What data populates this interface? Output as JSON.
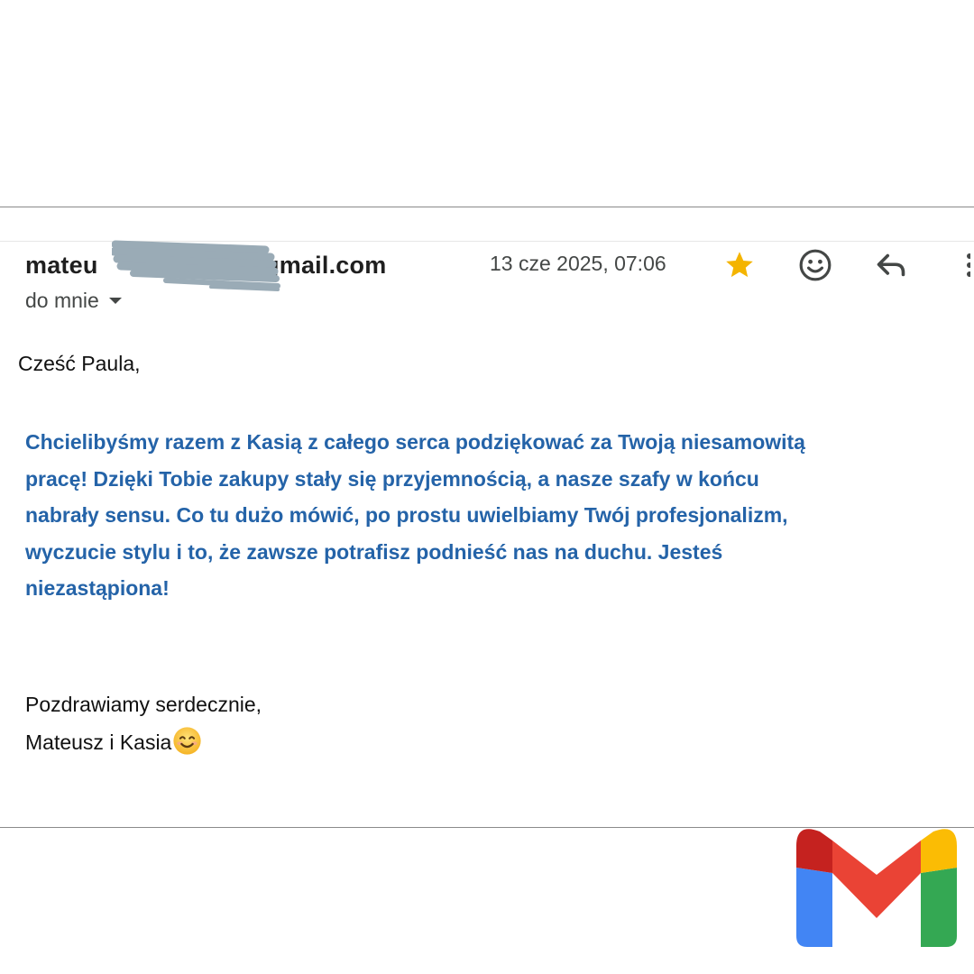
{
  "email": {
    "sender_visible_start": "mateu",
    "sender_visible_end": "@gmail.com",
    "date": "13 cze 2025, 07:06",
    "recipient_label": "do mnie",
    "starred": true,
    "star_color": "#f4b400"
  },
  "body": {
    "greeting": "Cześć Paula,",
    "message_lines": [
      "Chcielibyśmy razem z Kasią z całego serca podziękować za Twoją niesamowitą",
      "pracę! Dzięki Tobie zakupy stały się przyjemnością, a nasze szafy w końcu",
      "nabrały sensu. Co tu dużo mówić, po prostu uwielbiamy Twój profesjonalizm,",
      "wyczucie stylu i to, że zawsze potrafisz podnieść nas na duchu. Jesteś",
      "niezastąpiona!"
    ],
    "message_color": "#2463a8",
    "closing": "Pozdrawiamy serdecznie,",
    "signature": "Mateusz i Kasia"
  },
  "icons": {
    "star": "star-icon",
    "emoji_react": "emoji-icon",
    "reply": "reply-icon",
    "more": "more-vert-icon",
    "dropdown": "caret-down-icon",
    "smiley": "smiling-face-icon",
    "logo": "gmail-logo"
  },
  "brand_colors": [
    "#c5221f",
    "#ea4335",
    "#fbbc04",
    "#4285f4",
    "#34a853"
  ]
}
